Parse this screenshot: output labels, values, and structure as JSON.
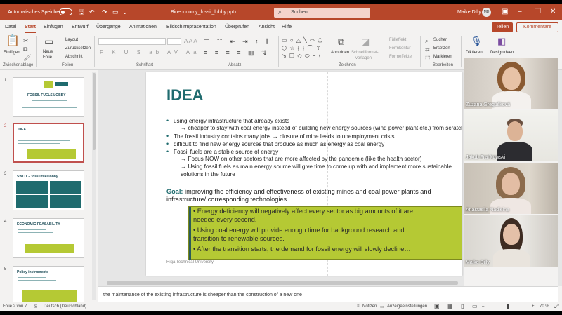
{
  "titlebar": {
    "autosave_label": "Automatisches Speichern",
    "filename": "Bioeconomy_fossil_lobby.pptx",
    "search_placeholder": "Suchen",
    "user_name": "Maike Dilly",
    "user_initials": "MD"
  },
  "menu": {
    "tabs": [
      "Datei",
      "Start",
      "Einfügen",
      "Entwurf",
      "Übergänge",
      "Animationen",
      "Bildschirmpräsentation",
      "Überprüfen",
      "Ansicht",
      "Hilfe"
    ],
    "active_tab": "Start",
    "share_label": "Teilen",
    "comments_label": "Kommentare"
  },
  "ribbon": {
    "clipboard": {
      "paste": "Einfügen",
      "label": "Zwischenablage"
    },
    "slides": {
      "new_slide_line1": "Neue",
      "new_slide_line2": "Folie",
      "layout": "Layout",
      "reset": "Zurücksetzen",
      "section": "Abschnitt",
      "label": "Folien"
    },
    "font": {
      "label": "Schriftart"
    },
    "paragraph": {
      "label": "Absatz"
    },
    "drawing": {
      "arrange": "Anordnen",
      "styles_line1": "Schnellformat-",
      "styles_line2": "vorlagen",
      "fill": "Fülleffekt",
      "outline": "Formkontur",
      "effects": "Formeffekte",
      "label": "Zeichnen"
    },
    "editing": {
      "find": "Suchen",
      "replace": "Ersetzen",
      "select": "Markieren",
      "label": "Bearbeiten"
    },
    "dictate": "Diktieren",
    "designer": "Designideen"
  },
  "thumbnails": [
    {
      "number": "1",
      "title": "FOSSIL FUELS LOBBY"
    },
    {
      "number": "2",
      "title": "IDEA"
    },
    {
      "number": "3",
      "title": "SWOT – fossil fuel lobby"
    },
    {
      "number": "4",
      "title": "ECONOMIC FEASABILITY"
    },
    {
      "number": "5",
      "title": "Policy instruments"
    }
  ],
  "slide": {
    "title": "IDEA",
    "bullets": [
      "using energy infrastructure that already exists",
      "The fossil industry contains many jobs → closure of mine leads to unemployment crisis",
      "difficult to find new energy sources that produce as much as energy as coal energy",
      "Fossil fuels are a stable source of energy"
    ],
    "sub_bullets": [
      "→ cheaper to stay with coal energy instead of building new energy sources (wind power plant etc.) from scratch",
      "→ Focus NOW on other sectors that are more affected by the pandemic (like the health sector)",
      "→ Using fossil fuels as main energy source will give time to come up with and implement more sustainable",
      "solutions in the future"
    ],
    "goal_label": "Goal:",
    "goal_text_1": " improving the efficiency and effectiveness of existing mines and coal power plants and",
    "goal_text_2": "infrastructure/ corresponding technologies",
    "box_lines": [
      "•    Energy deficiency will negatively affect every sector as big amounts of it are",
      "      needed every second.",
      "•    Using coal energy will provide enough time for background research and",
      "      transition to renewable sources.",
      "•    After the transition starts, the demand for fossil energy will slowly decline…"
    ],
    "footer": "Riga Technical University"
  },
  "participants": [
    {
      "name": "Zuzana Gregušková"
    },
    {
      "name": "Jakub Frańkowski"
    },
    {
      "name": "Anastasiia Nadieina"
    },
    {
      "name": "Maike Dilly"
    }
  ],
  "notes": "the maintenance of the existing infrastructure is cheaper than the construction of a new one",
  "status": {
    "slide_counter": "Folie 2 von 7",
    "language": "Deutsch (Deutschland)",
    "notes_btn": "Notizen",
    "display_settings": "Anzeigeeinstellungen",
    "zoom": "70 %"
  },
  "colors": {
    "accent": "#b7472a",
    "slide_title": "#1f6b6e",
    "goal_box": "#b5c934"
  }
}
